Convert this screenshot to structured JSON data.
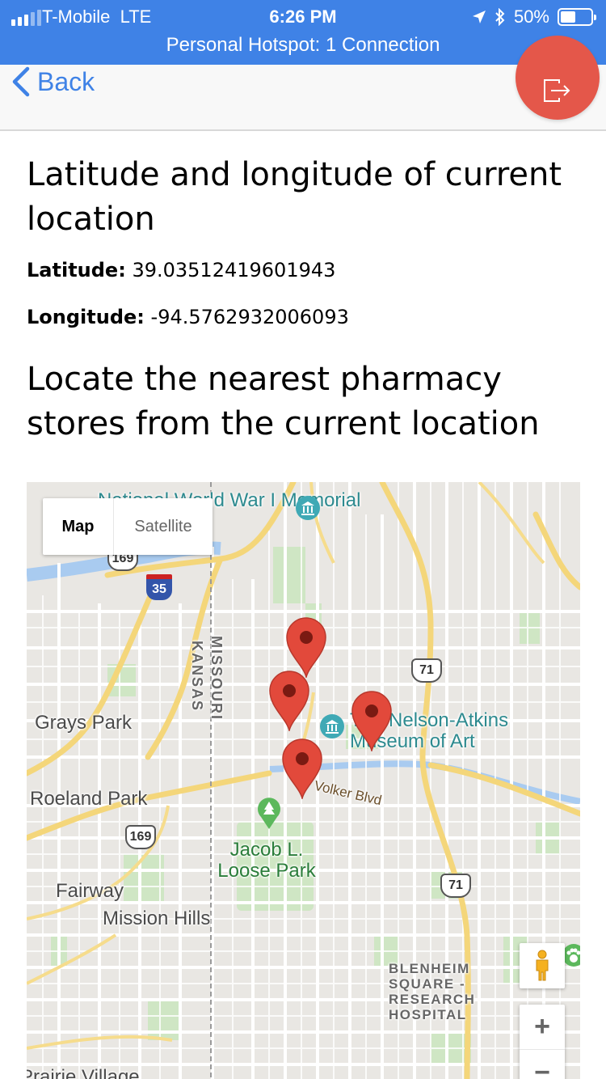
{
  "status_bar": {
    "carrier": "T-Mobile",
    "network": "LTE",
    "time": "6:26 PM",
    "battery": "50%",
    "battery_level": 0.5,
    "hotspot": "Personal Hotspot: 1 Connection"
  },
  "nav": {
    "back_label": "Back",
    "back_icon": "chevron-left-icon",
    "logout_icon": "logout-icon",
    "accent_color": "#3f82e6",
    "logout_color": "#e4574a"
  },
  "content": {
    "heading_location": "Latitude and longitude of current location",
    "latitude_label": "Latitude:",
    "latitude_value": "39.03512419601943",
    "longitude_label": "Longitude:",
    "longitude_value": "-94.5762932006093",
    "heading_pharmacy": "Locate the nearest pharmacy stores from the current location"
  },
  "map": {
    "type_map": "Map",
    "type_satellite": "Satellite",
    "zoom_in": "+",
    "zoom_out": "−",
    "marker_count": 4,
    "labels": {
      "wwi": "National World War I Memorial",
      "grays_park": "Grays Park",
      "roeland_park": "Roeland Park",
      "fairway": "Fairway",
      "mission_hills": "Mission Hills",
      "prairie_village": "Prairie Village",
      "nelson": "The Nelson-Atkins Museum of Art",
      "volker": "Volker Blvd",
      "loose_park": "Jacob L. Loose Park",
      "blenheim": "BLENHEIM SQUARE - RESEARCH HOSPITAL",
      "missouri": "MISSOURI",
      "kansas": "KANSAS"
    },
    "shields": {
      "i35": "35",
      "us169_top": "169",
      "us169_mid": "169",
      "us71_top": "71",
      "us71_bottom": "71"
    }
  }
}
